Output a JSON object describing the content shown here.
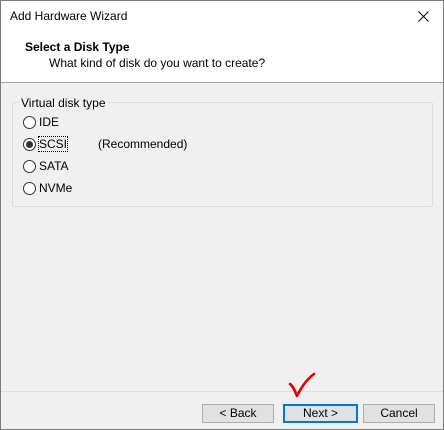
{
  "window": {
    "title": "Add Hardware Wizard"
  },
  "header": {
    "title": "Select a Disk Type",
    "subtitle": "What kind of disk do you want to create?"
  },
  "disk_type_group": {
    "legend": "Virtual disk type",
    "options": [
      {
        "label": "IDE",
        "checked": false,
        "note": ""
      },
      {
        "label": "SCSI",
        "checked": true,
        "note": "(Recommended)"
      },
      {
        "label": "SATA",
        "checked": false,
        "note": ""
      },
      {
        "label": "NVMe",
        "checked": false,
        "note": ""
      }
    ]
  },
  "footer": {
    "back_label": "< Back",
    "next_label": "Next >",
    "cancel_label": "Cancel"
  },
  "colors": {
    "annotation_check": "#e60000",
    "primary_button_border": "#0078d7"
  },
  "icons": {
    "close": "close-icon",
    "annotation": "checkmark-icon"
  }
}
